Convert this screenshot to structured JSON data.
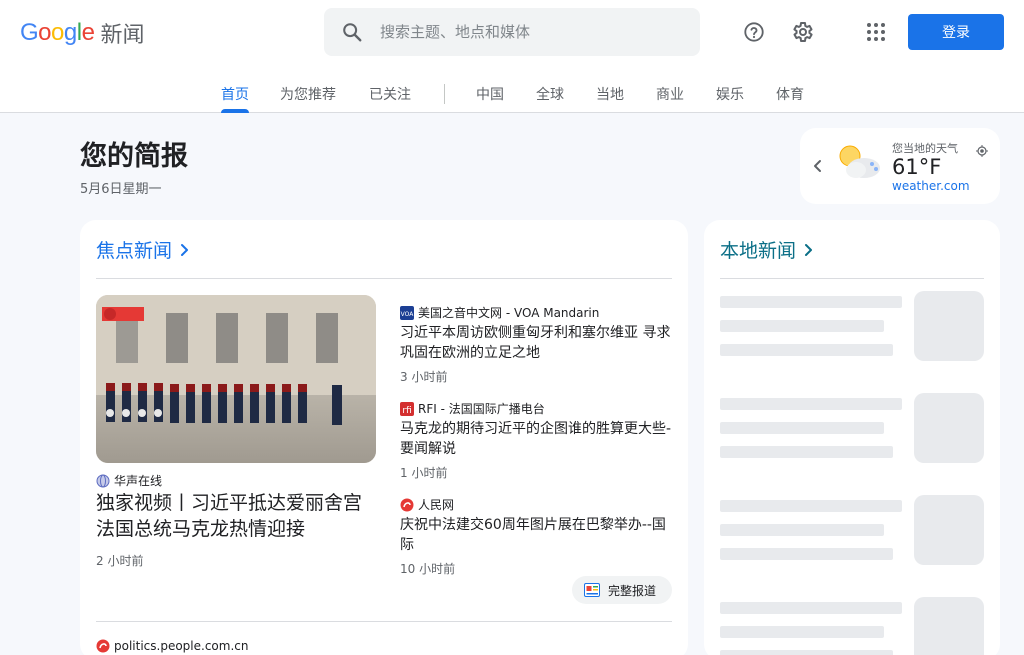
{
  "header": {
    "logo_word": "Google",
    "logo_news": "新闻",
    "search_placeholder": "搜索主题、地点和媒体",
    "login_label": "登录"
  },
  "tabs": [
    {
      "label": "首页",
      "active": true
    },
    {
      "label": "为您推荐"
    },
    {
      "label": "已关注"
    },
    {
      "label": "中国"
    },
    {
      "label": "全球"
    },
    {
      "label": "当地"
    },
    {
      "label": "商业"
    },
    {
      "label": "娱乐"
    },
    {
      "label": "体育"
    }
  ],
  "briefing": {
    "title": "您的简报",
    "date": "5月6日星期一"
  },
  "weather": {
    "location": "您当地的天气",
    "temperature": "61°F",
    "source": "weather.com"
  },
  "top_stories": {
    "heading": "焦点新闻",
    "hero": {
      "source": "华声在线",
      "title": "独家视频丨习近平抵达爱丽舍宫 法国总统马克龙热情迎接",
      "time": "2 小时前"
    },
    "stories": [
      {
        "source": "美国之音中文网 - VOA Mandarin",
        "title": "习近平本周访欧侧重匈牙利和塞尔维亚 寻求巩固在欧洲的立足之地",
        "time": "3 小时前"
      },
      {
        "source": "RFI - 法国国际广播电台",
        "title": "马克龙的期待习近平的企图谁的胜算更大些- 要闻解说",
        "time": "1 小时前"
      },
      {
        "source": "人民网",
        "title": "庆祝中法建交60周年图片展在巴黎举办--国际",
        "time": "10 小时前"
      }
    ],
    "full_coverage_label": "完整报道",
    "next_source": "politics.people.com.cn"
  },
  "local_news": {
    "heading": "本地新闻"
  },
  "colors": {
    "accent": "#1a73e8",
    "local_heading": "#0b6f87",
    "background": "#f6f8fc"
  }
}
